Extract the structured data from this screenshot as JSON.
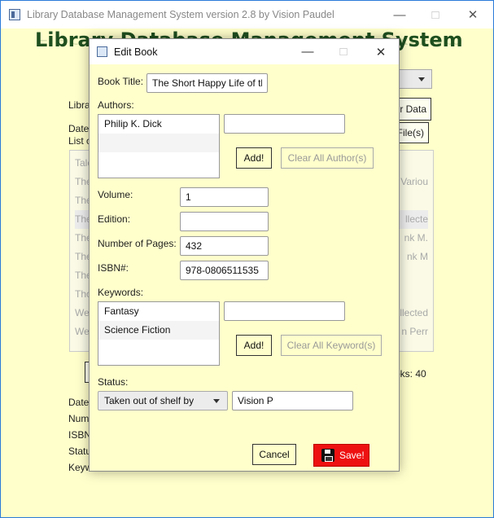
{
  "main_window": {
    "title": "Library Database Management System version 2.8 by Vision Paudel",
    "heading": "Library Database Management System",
    "partial_labels": {
      "library": "Libra",
      "date": "Date",
      "list": "List c",
      "date2": "Date",
      "num": "Num",
      "isbn": "ISBN",
      "status": "Statu",
      "keyw": "Keyw"
    },
    "partial_buttons": {
      "data": "r Data",
      "files": "File(s)"
    },
    "books_count": "oks: 40",
    "table_rows": [
      {
        "left": "Tale",
        "right": ""
      },
      {
        "left": "The",
        "right": "Variou"
      },
      {
        "left": "The",
        "right": ""
      },
      {
        "left": "The",
        "right": "llecte"
      },
      {
        "left": "The",
        "right": "nk M."
      },
      {
        "left": "The",
        "right": "nk M"
      },
      {
        "left": "The",
        "right": ""
      },
      {
        "left": "Tho",
        "right": ""
      },
      {
        "left": "We",
        "right": "llected"
      },
      {
        "left": "We",
        "right": "n Perr"
      }
    ]
  },
  "dialog": {
    "title": "Edit Book",
    "book_title_label": "Book Title:",
    "book_title_value": "The Short Happy Life of th",
    "authors_label": "Authors:",
    "authors": [
      "Philip K. Dick"
    ],
    "author_input_value": "",
    "add_author_label": "Add!",
    "clear_authors_label": "Clear All Author(s)",
    "volume_label": "Volume:",
    "volume_value": "1",
    "edition_label": "Edition:",
    "edition_value": "",
    "pages_label": "Number of Pages:",
    "pages_value": "432",
    "isbn_label": "ISBN#:",
    "isbn_value": "978-0806511535",
    "keywords_label": "Keywords:",
    "keywords": [
      "Fantasy",
      "Science Fiction"
    ],
    "keyword_input_value": "",
    "add_keyword_label": "Add!",
    "clear_keywords_label": "Clear All Keyword(s)",
    "status_label": "Status:",
    "status_selected": "Taken out of shelf by",
    "status_person": "Vision P",
    "cancel_label": "Cancel",
    "save_label": "Save!"
  },
  "colors": {
    "background": "#ffffcc",
    "heading": "#1f4f1f",
    "save": "#ee1111"
  }
}
